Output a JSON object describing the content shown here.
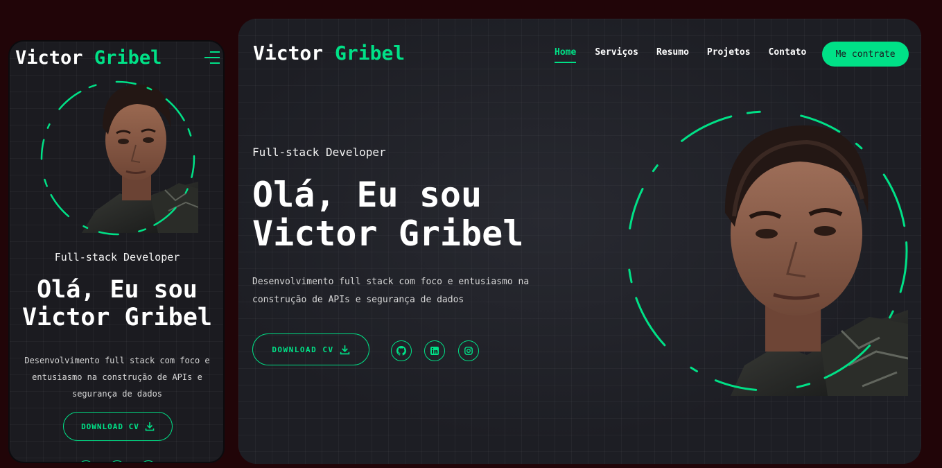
{
  "brand": {
    "first": "Victor",
    "last": "Gribel"
  },
  "nav": {
    "items": [
      "Home",
      "Serviços",
      "Resumo",
      "Projetos",
      "Contato"
    ],
    "active": "Home"
  },
  "hire_button": "Me contrate",
  "hero": {
    "role": "Full-stack Developer",
    "title_line1": "Olá, Eu sou",
    "title_line2": "Victor Gribel",
    "description": "Desenvolvimento full stack com foco e entusiasmo na construção de APIs e segurança de dados",
    "download_cv": "DOWNLOAD CV"
  },
  "social_icons": [
    "github-icon",
    "linkedin-icon",
    "instagram-icon"
  ],
  "colors": {
    "accent": "#00e187",
    "background": "#210508",
    "panel": "#1d1e24"
  }
}
